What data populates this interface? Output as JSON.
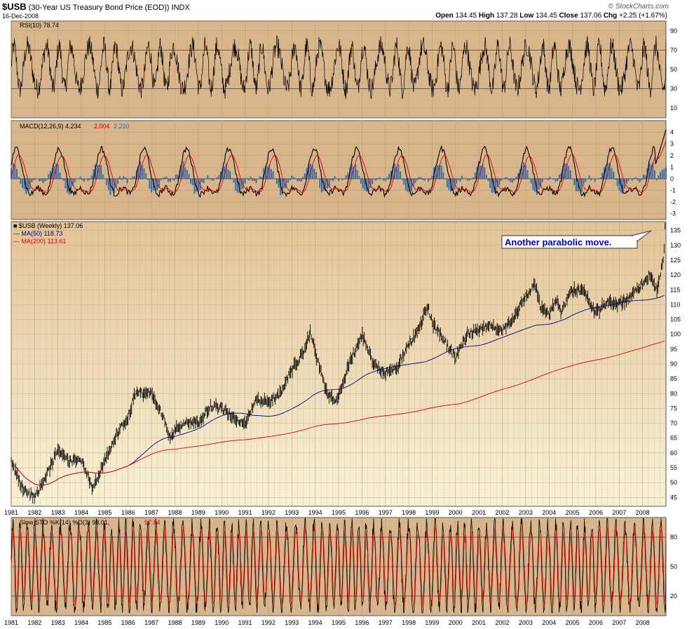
{
  "header": {
    "symbol": "$USB",
    "name": "(30-Year US Treasury Bond Price (EOD))",
    "exchange": "INDX",
    "date": "16-Dec-2008",
    "credit": "© StockCharts.com",
    "open_label": "Open",
    "open": "134.45",
    "high_label": "High",
    "high": "137.28",
    "low_label": "Low",
    "low": "134.45",
    "close_label": "Close",
    "close": "137.06",
    "chg_label": "Chg",
    "chg": "+2.25 (+1.67%)"
  },
  "colors": {
    "panel_bg": "#d9b58c",
    "price_bg_top": "#e3c498",
    "price_bg_bottom": "#f7efd2",
    "price_line": "#000000",
    "ma50": "#00008b",
    "ma200": "#e00000",
    "macd_hist": "#3a6ea5",
    "rsi_ob": "#3a7a3a",
    "rsi_os": "#a04040",
    "annotation_text": "#0000cc"
  },
  "chart_data": [
    {
      "type": "line",
      "panel": "rsi",
      "legend": "RSI(10)",
      "value": "78.74",
      "ylim": [
        0,
        100
      ],
      "yticks": [
        10,
        30,
        50,
        70,
        90
      ],
      "levels": [
        30,
        70
      ]
    },
    {
      "type": "line",
      "panel": "macd",
      "legend": "MACD(12,26,9)",
      "macd_value": "4.234",
      "signal_value": "2.004",
      "hist_value": "2.230",
      "ylim": [
        -3.5,
        5
      ],
      "yticks": [
        -3,
        -2,
        -1,
        0,
        1,
        2,
        3,
        4
      ]
    },
    {
      "type": "line",
      "panel": "price",
      "legend": "$USB (Weekly)",
      "value": "137.06",
      "ma50_label": "MA(50)",
      "ma50_value": "118.73",
      "ma200_label": "MA(200)",
      "ma200_value": "113.61",
      "ylim": [
        42,
        138
      ],
      "yticks": [
        45,
        50,
        55,
        60,
        65,
        70,
        75,
        80,
        85,
        90,
        95,
        100,
        105,
        110,
        115,
        120,
        125,
        130,
        135
      ],
      "x": [
        1981.0,
        1981.5,
        1982.0,
        1982.5,
        1983.0,
        1983.5,
        1984.0,
        1984.5,
        1985.0,
        1985.5,
        1986.0,
        1986.3,
        1986.7,
        1987.0,
        1987.5,
        1987.8,
        1988.0,
        1988.5,
        1989.0,
        1989.5,
        1990.0,
        1990.5,
        1991.0,
        1991.5,
        1992.0,
        1992.5,
        1993.0,
        1993.5,
        1993.8,
        1994.0,
        1994.5,
        1994.9,
        1995.5,
        1996.0,
        1996.5,
        1997.0,
        1997.5,
        1998.0,
        1998.5,
        1998.8,
        1999.0,
        1999.5,
        2000.0,
        2000.5,
        2001.0,
        2001.5,
        2002.0,
        2002.5,
        2003.0,
        2003.4,
        2003.6,
        2004.0,
        2004.3,
        2004.5,
        2005.0,
        2005.5,
        2006.0,
        2006.5,
        2007.0,
        2007.5,
        2008.0,
        2008.3,
        2008.6,
        2008.8,
        2008.9,
        2008.96
      ],
      "y": [
        57,
        48,
        45,
        52,
        61,
        57,
        57,
        48,
        57,
        66,
        72,
        80,
        80,
        80,
        72,
        65,
        68,
        70,
        70,
        76,
        75,
        72,
        70,
        78,
        77,
        80,
        88,
        94,
        101,
        94,
        80,
        77,
        91,
        100,
        90,
        87,
        89,
        96,
        103,
        110,
        104,
        98,
        92,
        100,
        102,
        103,
        101,
        106,
        113,
        117,
        110,
        106,
        112,
        107,
        115,
        115,
        107,
        111,
        110,
        113,
        117,
        120,
        115,
        122,
        126,
        137
      ]
    },
    {
      "type": "line",
      "panel": "sto",
      "legend": "Slow STO %K(14) %D(3)",
      "k_value": "98.01",
      "d_value": "97.84",
      "ylim": [
        0,
        100
      ],
      "yticks": [
        20,
        50,
        80
      ]
    }
  ],
  "x_axis": {
    "years": [
      "1981",
      "1982",
      "1983",
      "1984",
      "1985",
      "1986",
      "1987",
      "1988",
      "1989",
      "1990",
      "1991",
      "1992",
      "1993",
      "1994",
      "1995",
      "1996",
      "1997",
      "1998",
      "1999",
      "2000",
      "2001",
      "2002",
      "2003",
      "2004",
      "2005",
      "2006",
      "2007",
      "2008"
    ]
  },
  "annotation": {
    "text": "Another parabolic move."
  }
}
